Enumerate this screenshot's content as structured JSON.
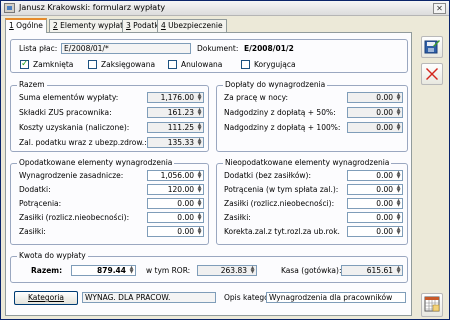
{
  "window": {
    "title": "Janusz Krakowski: formularz wypłaty"
  },
  "tabs": [
    {
      "key": "1",
      "label": "Ogólne"
    },
    {
      "key": "2",
      "label": "Elementy wypłaty"
    },
    {
      "key": "3",
      "label": "Podatki"
    },
    {
      "key": "4",
      "label": "Ubezpieczenie"
    }
  ],
  "header": {
    "lista_label": "Lista płac:",
    "lista_value": "E/2008/01/*",
    "dokument_label": "Dokument:",
    "dokument_value": "E/2008/01/2",
    "checkboxes": [
      {
        "label": "Zamknięta",
        "checked": true
      },
      {
        "label": "Zaksięgowana",
        "checked": false
      },
      {
        "label": "Anulowana",
        "checked": false
      },
      {
        "label": "Korygująca",
        "checked": false
      }
    ]
  },
  "razem": {
    "title": "Razem",
    "rows": [
      {
        "label": "Suma elementów wypłaty:",
        "value": "1,176.00"
      },
      {
        "label": "Składki ZUS pracownika:",
        "value": "161.23"
      },
      {
        "label": "Koszty uzyskania (naliczone):",
        "value": "111.25"
      },
      {
        "label": "Zal. podatku wraz z  ubezp.zdrow.:",
        "value": "135.33"
      }
    ]
  },
  "doplaty": {
    "title": "Dopłaty do wynagrodzenia",
    "rows": [
      {
        "label": "Za pracę w nocy:",
        "value": "0.00"
      },
      {
        "label": "Nadgodziny z dopłatą + 50%:",
        "value": "0.00"
      },
      {
        "label": "Nadgodziny z dopłatą + 100%:",
        "value": "0.00"
      }
    ]
  },
  "opodatkowane": {
    "title": "Opodatkowane elementy wynagrodzenia",
    "rows": [
      {
        "label": "Wynagrodzenie zasadnicze:",
        "value": "1,056.00"
      },
      {
        "label": "Dodatki:",
        "value": "120.00"
      },
      {
        "label": "Potrącenia:",
        "value": "0.00"
      },
      {
        "label": "Zasiłki (rozlicz.nieobecności):",
        "value": "0.00"
      },
      {
        "label": "Zasiłki:",
        "value": "0.00"
      }
    ]
  },
  "nieopodatkowane": {
    "title": "Nieopodatkowane elementy wynagrodzenia",
    "rows": [
      {
        "label": "Dodatki (bez zasiłków):",
        "value": "0.00"
      },
      {
        "label": "Potrącenia (w tym spłata zal.):",
        "value": "0.00"
      },
      {
        "label": "Zasiłki (rozlicz.nieobecności):",
        "value": "0.00"
      },
      {
        "label": "Zasiłki:",
        "value": "0.00"
      },
      {
        "label": "Korekta.zal.z tyt.rozl.za ub.rok.",
        "value": "0.00"
      }
    ]
  },
  "kwota": {
    "title": "Kwota do wypłaty",
    "razem_label": "Razem:",
    "razem_value": "879.44",
    "ror_label": "w tym ROR:",
    "ror_value": "263.83",
    "kasa_label": "Kasa (gotówka):",
    "kasa_value": "615.61"
  },
  "footer": {
    "kategoria_button": "Kategoria",
    "kategoria_value": "WYNAG. DLA PRACOW.",
    "opis_label": "Opis kategorii:",
    "opis_value": "Wynagrodzenia dla pracowników"
  },
  "toolbar": {
    "save_icon": "save-disk-icon",
    "cancel_icon": "red-x-icon",
    "bottom_icon": "calendar-grid-icon"
  }
}
